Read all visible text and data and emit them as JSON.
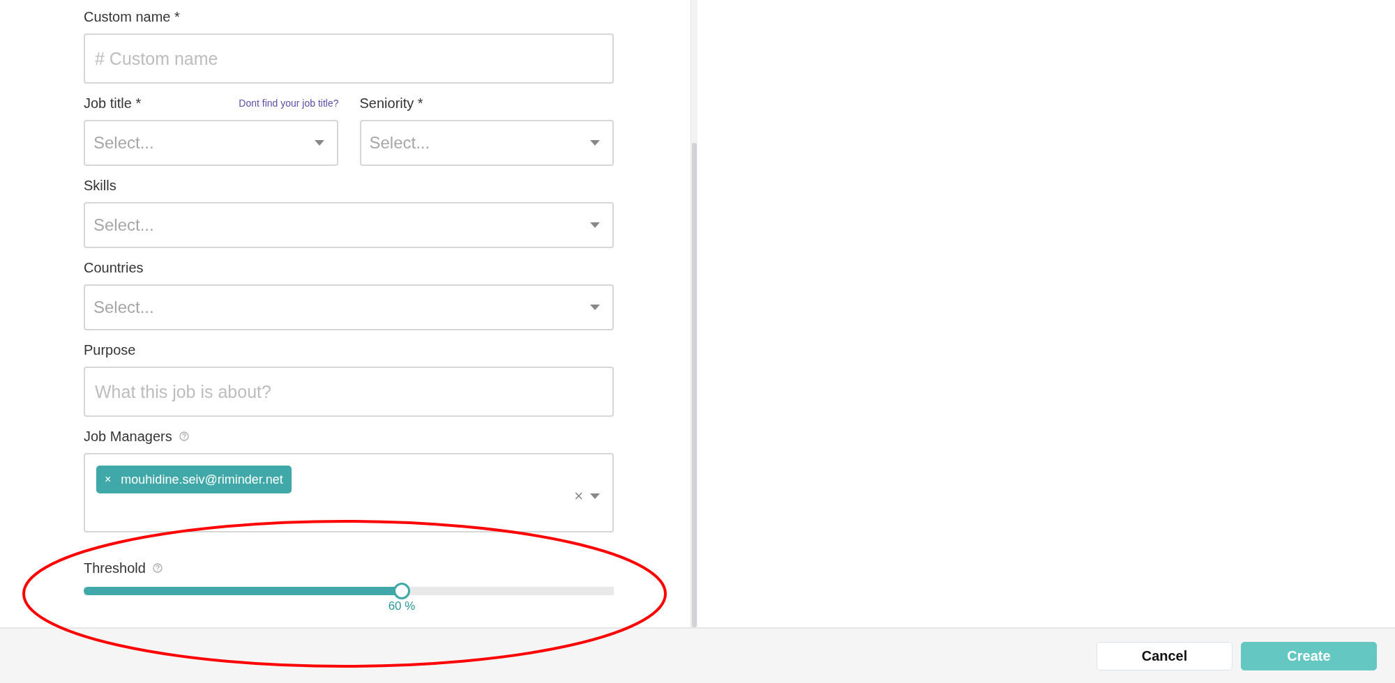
{
  "form": {
    "fields": [
      {
        "kind": "input",
        "label": "Custom name *",
        "placeholder": "# Custom name"
      },
      {
        "kind": "select-pair",
        "items": [
          {
            "label": "Job title *",
            "link": "Dont find your job title?",
            "placeholder": "Select..."
          },
          {
            "label": "Seniority *",
            "placeholder": "Select..."
          }
        ]
      },
      {
        "kind": "select",
        "label": "Skills",
        "placeholder": "Select..."
      },
      {
        "kind": "select",
        "label": "Countries",
        "placeholder": "Select..."
      },
      {
        "kind": "input",
        "label": "Purpose",
        "placeholder": "What this job is about?"
      },
      {
        "kind": "tags",
        "label": "Job Managers",
        "help": true,
        "tags": [
          {
            "remove": "×",
            "text": "mouhidine.seiv@riminder.net"
          }
        ],
        "clear": "×"
      },
      {
        "kind": "slider",
        "label": "Threshold",
        "help": true,
        "level": 0.6,
        "reading": "60 %"
      }
    ]
  },
  "footer": {
    "buttons": [
      {
        "label": "Cancel",
        "kind": "secondary"
      },
      {
        "label": "Create",
        "kind": "primary"
      }
    ]
  }
}
